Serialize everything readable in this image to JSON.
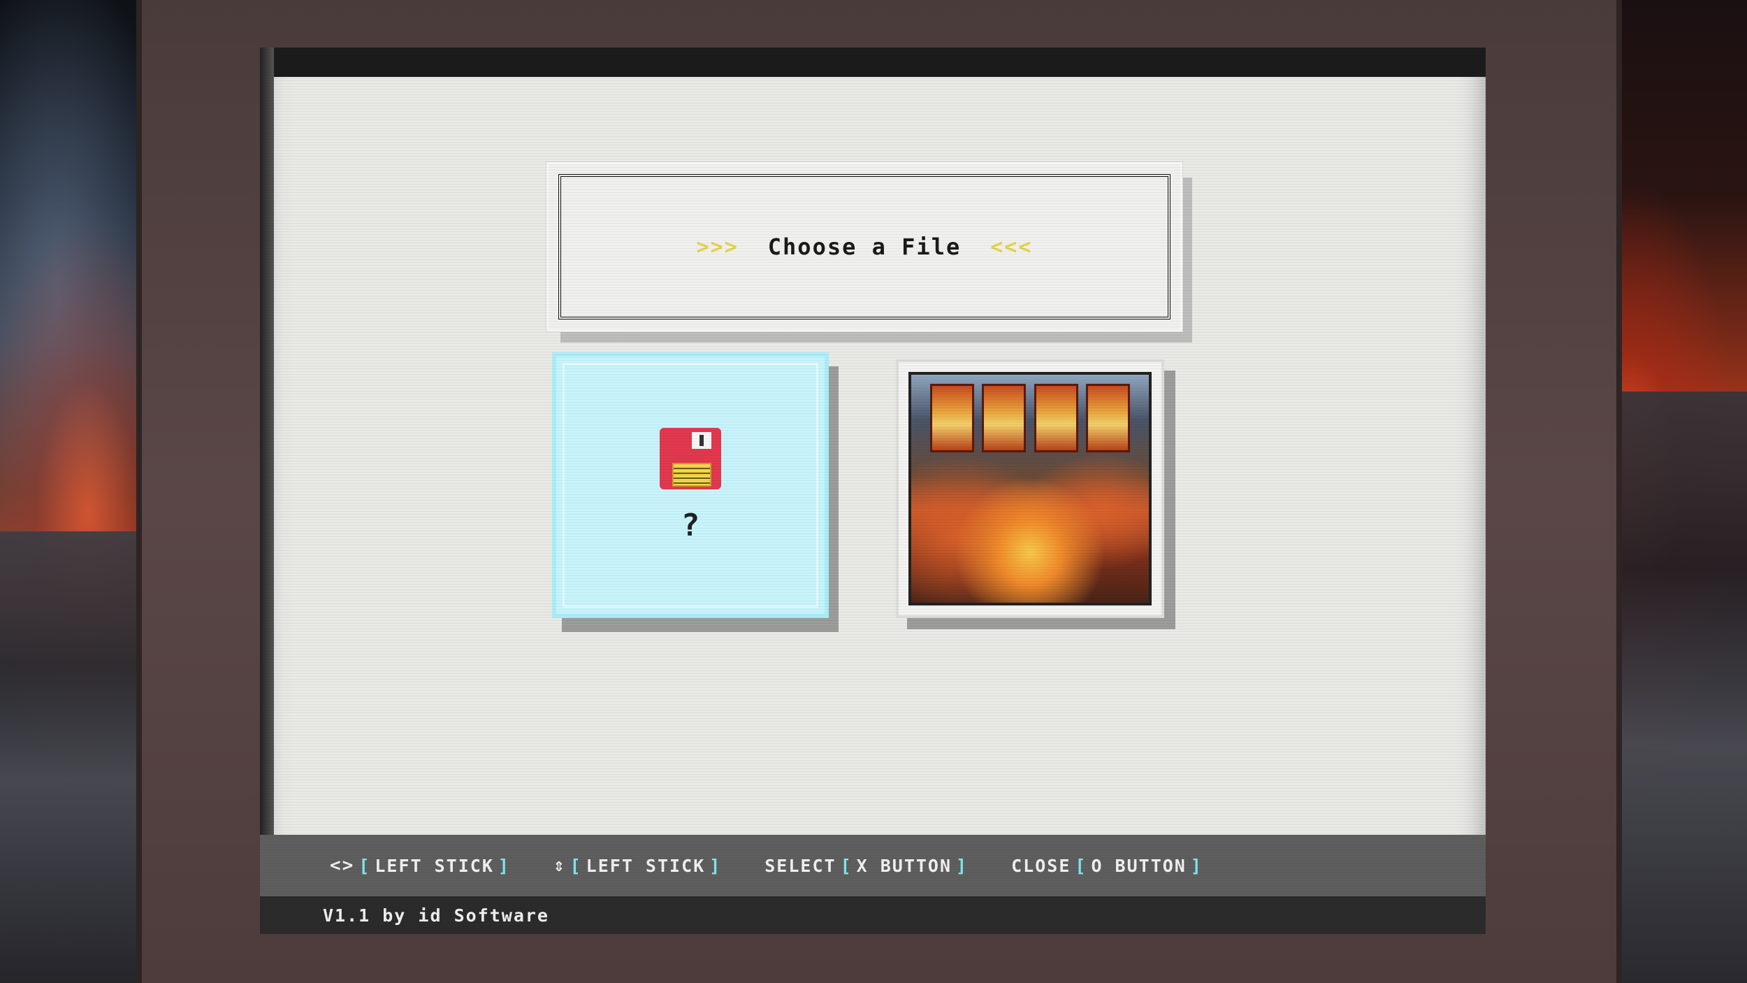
{
  "title": {
    "left_chevrons": ">>>",
    "text": "Choose a File",
    "right_chevrons": "<<<"
  },
  "cards": {
    "new_file_symbol": "?",
    "icon_new": "floppy-disk-icon",
    "doom_cover": "doom-cover-art"
  },
  "controls": [
    {
      "glyph": "<>",
      "open": "[",
      "label": "LEFT STICK",
      "close": "]"
    },
    {
      "glyph": "⇕",
      "open": "[",
      "label": "LEFT STICK",
      "close": "]"
    },
    {
      "action": "SELECT",
      "open": "[",
      "label": "X BUTTON",
      "close": "]"
    },
    {
      "action": "CLOSE",
      "open": "[",
      "label": "O BUTTON",
      "close": "]"
    }
  ],
  "version": "V1.1 by id Software",
  "colors": {
    "screen_bg": "#e9e9e6",
    "selected_card": "#c7f4fb",
    "accent_bracket": "#7fe6ee",
    "chevron": "#e3d34d",
    "footer_bar": "#5e5e5e"
  }
}
